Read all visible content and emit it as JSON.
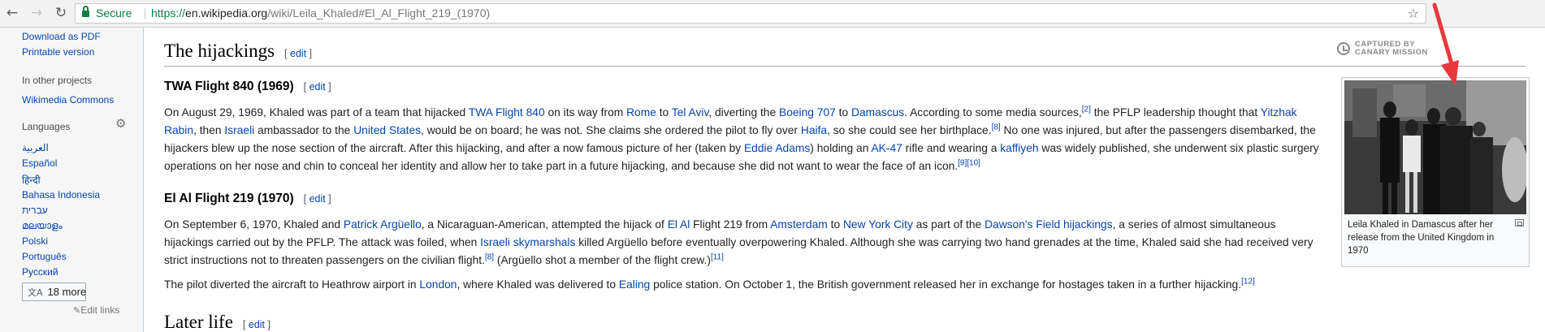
{
  "browser": {
    "secure_label": "Secure",
    "url_scheme": "https://",
    "url_host": "en.wikipedia.org",
    "url_path": "/wiki/Leila_Khaled#El_Al_Flight_219_(1970)",
    "icons": [
      "back-arrow-icon",
      "forward-arrow-icon",
      "reload-icon",
      "lock-icon",
      "star-icon"
    ]
  },
  "sidebar": {
    "download_pdf": "Download as PDF",
    "printable_version": "Printable version",
    "other_projects_heading": "In other projects",
    "wikimedia_commons": "Wikimedia Commons",
    "languages_heading": "Languages",
    "languages": [
      "العربية",
      "Español",
      "हिन्दी",
      "Bahasa Indonesia",
      "עברית",
      "മലയാളം",
      "Polski",
      "Português",
      "Русский"
    ],
    "more_languages": "18 more",
    "edit_links": "Edit links"
  },
  "article": {
    "section_hijackings": "The hijackings",
    "section_later_life": "Later life",
    "edit_label": "edit",
    "sub_twa": "TWA Flight 840 (1969)",
    "sub_elal": "El Al Flight 219 (1970)",
    "p1": {
      "t1": "On August 29, 1969, Khaled was part of a team that hijacked ",
      "l_twa": "TWA Flight 840",
      "t2": " on its way from ",
      "l_rome": "Rome",
      "t3": " to ",
      "l_telaviv": "Tel Aviv",
      "t4": ", diverting the ",
      "l_boeing": "Boeing 707",
      "t5": " to ",
      "l_damascus": "Damascus",
      "t6": ". According to some media sources,",
      "ref2": "[2]",
      "t7": " the PFLP leadership thought that ",
      "l_rabin": "Yitzhak Rabin",
      "t8": ", then ",
      "l_israeli": "Israeli",
      "t9": " ambassador to the ",
      "l_us": "United States",
      "t10": ", would be on board; he was not. She claims she ordered the pilot to fly over ",
      "l_haifa": "Haifa",
      "t11": ", so she could see her birthplace.",
      "ref8": "[8]",
      "t12": " No one was injured, but after the passengers disembarked, the hijackers blew up the nose section of the aircraft. After this hijacking, and after a now famous picture of her (taken by ",
      "l_adams": "Eddie Adams",
      "t13": ") holding an ",
      "l_ak47": "AK-47",
      "t14": " rifle and wearing a ",
      "l_kaffiyeh": "kaffiyeh",
      "t15": " was widely published, she underwent six plastic surgery operations on her nose and chin to conceal her identity and allow her to take part in a future hijacking, and because she did not want to wear the face of an icon.",
      "ref910": "[9][10]"
    },
    "p2": {
      "t1": "On September 6, 1970, Khaled and ",
      "l_arguello": "Patrick Argüello",
      "t2": ", a Nicaraguan-American, attempted the hijack of ",
      "l_elal": "El Al",
      "t3": " Flight 219 from ",
      "l_amsterdam": "Amsterdam",
      "t4": " to ",
      "l_nyc": "New York City",
      "t5": " as part of the ",
      "l_dawsons": "Dawson's Field hijackings",
      "t6": ", a series of almost simultaneous hijackings carried out by the PFLP. The attack was foiled, when ",
      "l_sky": "Israeli skymarshals",
      "t7": " killed Argüello before eventually overpowering Khaled. Although she was carrying two hand grenades at the time, Khaled said she had received very strict instructions not to threaten passengers on the civilian flight.",
      "ref8": "[8]",
      "t8": " (Argüello shot a member of the flight crew.)",
      "ref11": "[11]"
    },
    "p3": {
      "t1": "The pilot diverted the aircraft to Heathrow airport in ",
      "l_london": "London",
      "t2": ", where Khaled was delivered to ",
      "l_ealing": "Ealing",
      "t3": " police station. On October 1, the British government released her in exchange for hostages taken in a further hijacking.",
      "ref12": "[12]"
    },
    "thumb_caption": "Leila Khaled in Damascus after her release from the United Kingdom in 1970"
  },
  "watermark": {
    "line1": "CAPTURED BY",
    "line2": "CANARY MISSION"
  },
  "colors": {
    "link": "#0645ad",
    "secure_green": "#0b8043",
    "annotation_red": "#e8383d"
  }
}
